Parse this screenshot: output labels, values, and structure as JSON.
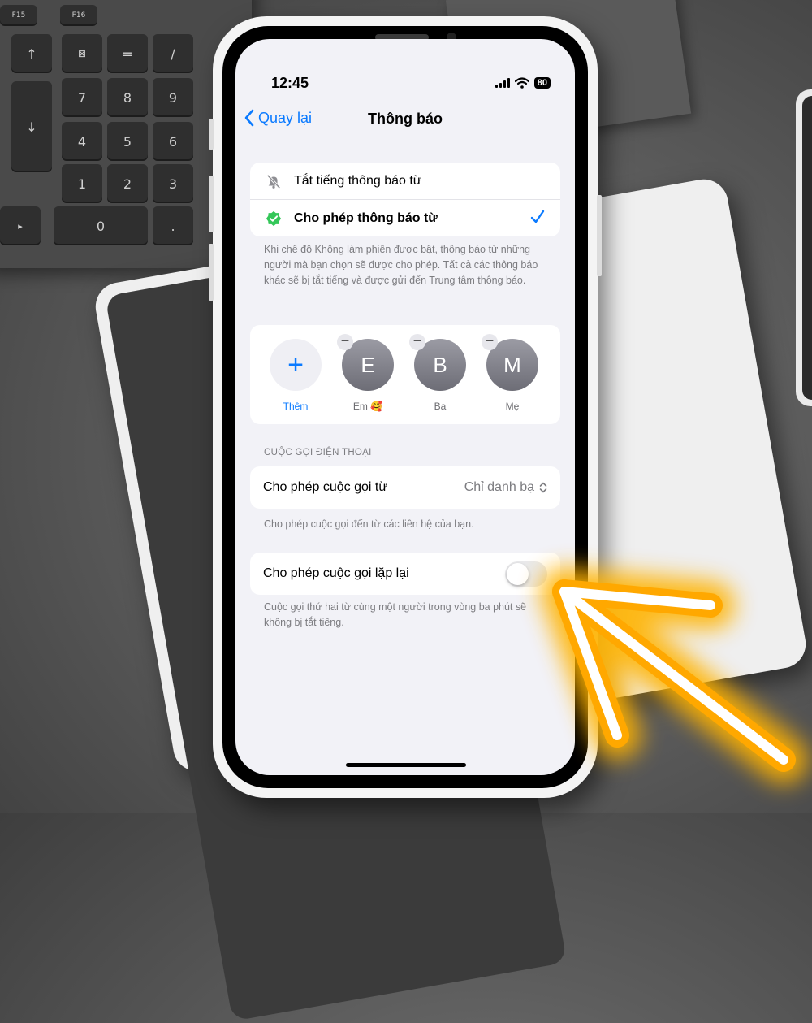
{
  "background": {
    "keyboard_keys": [
      "F15",
      "F16",
      "↑",
      "⊠",
      "=",
      "/",
      "↓",
      "7",
      "8",
      "9",
      "4",
      "5",
      "6",
      "1",
      "2",
      "3",
      "▸",
      "0",
      "."
    ]
  },
  "status_bar": {
    "time": "12:45",
    "battery": "80"
  },
  "nav": {
    "back_label": "Quay lại",
    "title": "Thông báo"
  },
  "notify_options": {
    "items": [
      {
        "label": "Tắt tiếng thông báo từ",
        "icon": "bell-slash-icon",
        "selected": false
      },
      {
        "label": "Cho phép thông báo từ",
        "icon": "checkmark-shield-icon",
        "selected": true
      }
    ],
    "footnote": "Khi chế độ Không làm phiền được bật, thông báo từ những người mà bạn chọn sẽ được cho phép. Tất cả các thông báo khác sẽ bị tắt tiếng và được gửi đến Trung tâm thông báo."
  },
  "people": {
    "add": {
      "symbol": "+",
      "label": "Thêm"
    },
    "contacts": [
      {
        "initial": "E",
        "name": "Em 🥰"
      },
      {
        "initial": "B",
        "name": "Ba"
      },
      {
        "initial": "M",
        "name": "Mẹ"
      }
    ]
  },
  "calls": {
    "header": "CUỘC GỌI ĐIỆN THOẠI",
    "allow_label": "Cho phép cuộc gọi từ",
    "allow_value": "Chỉ danh bạ",
    "allow_footnote": "Cho phép cuộc gọi đến từ các liên hệ của bạn.",
    "repeat_label": "Cho phép cuộc gọi lặp lại",
    "repeat_enabled": false,
    "repeat_footnote": "Cuộc gọi thứ hai từ cùng một người trong vòng ba phút sẽ không bị tắt tiếng."
  },
  "colors": {
    "accent": "#0a7aff",
    "arrow_glow": "#ffb300",
    "check_green": "#34c759"
  }
}
